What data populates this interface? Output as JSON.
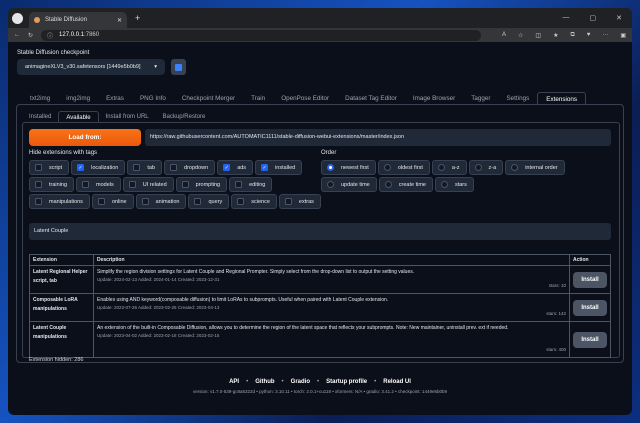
{
  "browser": {
    "tab_title": "Stable Diffusion",
    "url_host": "127.0.0.1",
    "url_port": ":7860"
  },
  "checkpoint": {
    "label": "Stable Diffusion checkpoint",
    "value": "animagineXLV3_v30.safetensors [1449e5b0b9]"
  },
  "main_tabs": [
    "txt2img",
    "img2img",
    "Extras",
    "PNG Info",
    "Checkpoint Merger",
    "Train",
    "OpenPose Editor",
    "Dataset Tag Editor",
    "Image Browser",
    "Tagger",
    "Settings",
    "Extensions"
  ],
  "active_main_tab": "Extensions",
  "sub_tabs": [
    "Installed",
    "Available",
    "Install from URL",
    "Backup/Restore"
  ],
  "active_sub_tab": "Available",
  "load_button": "Load from:",
  "index_url": "https://raw.githubusercontent.com/AUTOMATIC1111/stable-diffusion-webui-extensions/master/index.json",
  "hide_label": "Hide extensions with tags",
  "tags": [
    {
      "label": "script",
      "checked": false
    },
    {
      "label": "localization",
      "checked": true
    },
    {
      "label": "tab",
      "checked": false
    },
    {
      "label": "dropdown",
      "checked": false
    },
    {
      "label": "ads",
      "checked": true
    },
    {
      "label": "installed",
      "checked": true
    },
    {
      "label": "training",
      "checked": false
    },
    {
      "label": "models",
      "checked": false
    },
    {
      "label": "UI related",
      "checked": false
    },
    {
      "label": "prompting",
      "checked": false
    },
    {
      "label": "editing",
      "checked": false
    },
    {
      "label": "manipulations",
      "checked": false
    },
    {
      "label": "online",
      "checked": false
    },
    {
      "label": "animation",
      "checked": false
    },
    {
      "label": "query",
      "checked": false
    },
    {
      "label": "science",
      "checked": false
    },
    {
      "label": "extras",
      "checked": false
    }
  ],
  "order_label": "Order",
  "orders": [
    {
      "label": "newest first",
      "selected": true
    },
    {
      "label": "oldest first",
      "selected": false
    },
    {
      "label": "a-z",
      "selected": false
    },
    {
      "label": "z-a",
      "selected": false
    },
    {
      "label": "internal order",
      "selected": false
    },
    {
      "label": "update time",
      "selected": false
    },
    {
      "label": "create time",
      "selected": false
    },
    {
      "label": "stars",
      "selected": false
    }
  ],
  "search_value": "Latent Couple",
  "table": {
    "headers": [
      "Extension",
      "Description",
      "Action"
    ],
    "rows": [
      {
        "name": "Latent Regional Helper",
        "tags": "script, tab",
        "desc": "Simplify the region division settings for Latent Couple and Regional Prompter. Simply select from the drop-down list to output the setting values.",
        "meta": "Update: 2024-02-13 Added: 2024-01-14 Created: 2023-12-31",
        "stars": "stars: 10",
        "action": "Install"
      },
      {
        "name": "Composable LoRA",
        "tags": "manipulations",
        "desc": "Enables using AND keyword(composable diffusion) to limit LoRAs to subprompts. Useful when paired with Latent Couple extension.",
        "meta": "Update: 2023-07-26 Added: 2023-02-25 Created: 2023-04-13",
        "stars": "stars: 142",
        "action": "Install"
      },
      {
        "name": "Latent Couple",
        "tags": "manipulations",
        "desc": "An extension of the built-in Composable Diffusion, allows you to determine the region of the latent space that reflects your subprompts. Note: New maintainer, uninstall prev. ext if needed.",
        "meta": "Update: 2023-04-02 Added: 2023-02-18 Created: 2023-02-15",
        "stars": "stars: 400",
        "action": "Install"
      }
    ]
  },
  "hidden_text": "Extension hidden: 286",
  "footer_links": [
    "API",
    "Github",
    "Gradio",
    "Startup profile",
    "Reload UI"
  ],
  "version_line": "version: v1.7.0-539-gc8a5322d  •  python: 3.10.11  •  torch: 2.0.1+cu118  •  xformers: N/A  •  gradio: 3.41.2  •  checkpoint: 1449e5b0b9"
}
